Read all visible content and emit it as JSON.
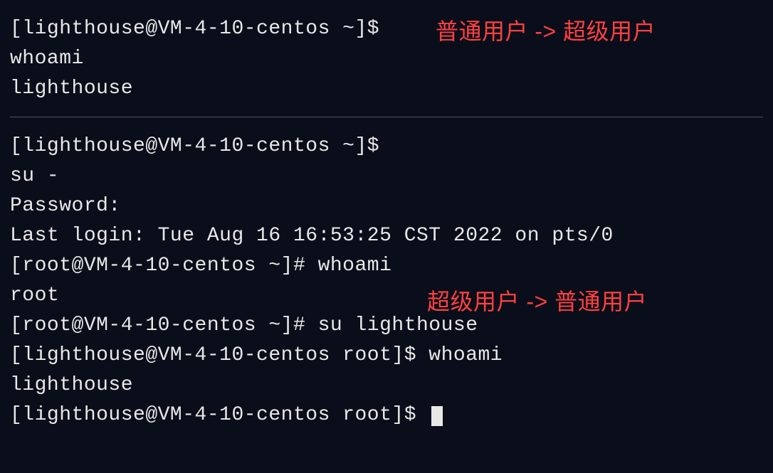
{
  "block1": {
    "line1_prompt": "[lighthouse@VM-4-10-centos ~]$ ",
    "line2": "whoami",
    "line3": "lighthouse"
  },
  "annotation1": "普通用户 -> 超级用户",
  "block2": {
    "line1": "[lighthouse@VM-4-10-centos ~]$ ",
    "line2": "su -",
    "line3": "Password:",
    "line4": "Last login: Tue Aug 16 16:53:25 CST 2022 on pts/0",
    "line5": "[root@VM-4-10-centos ~]# whoami",
    "line6": "root",
    "line7": "[root@VM-4-10-centos ~]# su lighthouse",
    "line8": "[lighthouse@VM-4-10-centos root]$ whoami",
    "line9": "lighthouse",
    "line10": "[lighthouse@VM-4-10-centos root]$ "
  },
  "annotation2": "超级用户 -> 普通用户"
}
